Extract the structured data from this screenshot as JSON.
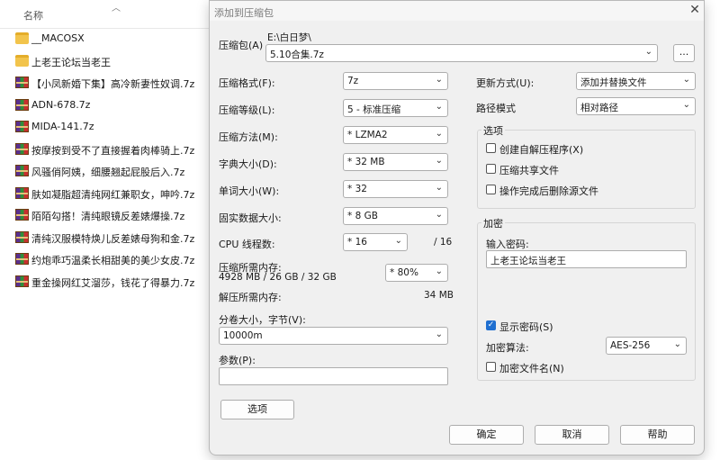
{
  "explorer": {
    "column_name": "名称",
    "files": [
      {
        "name": "__MACOSX",
        "icon": "folder-icon"
      },
      {
        "name": "上老王论坛当老王",
        "icon": "folder-icon"
      },
      {
        "name": "【小凤新婚下集】高冷新妻性奴调.7z",
        "icon": "rar-archive-icon"
      },
      {
        "name": "ADN-678.7z",
        "icon": "rar-archive-icon"
      },
      {
        "name": "MIDA-141.7z",
        "icon": "rar-archive-icon"
      },
      {
        "name": "按摩按到受不了直接握着肉棒骑上.7z",
        "icon": "rar-archive-icon"
      },
      {
        "name": "风骚俏阿姨，细腰翘起屁股后入.7z",
        "icon": "rar-archive-icon"
      },
      {
        "name": "肤如凝脂超清纯网红兼职女，呻吟.7z",
        "icon": "rar-archive-icon"
      },
      {
        "name": "陌陌勾搭！清纯眼镜反差婊爆操.7z",
        "icon": "rar-archive-icon"
      },
      {
        "name": "清纯汉服模特焕儿反差婊母狗和金.7z",
        "icon": "rar-archive-icon"
      },
      {
        "name": "约炮乖巧温柔长相甜美的美少女皮.7z",
        "icon": "rar-archive-icon"
      },
      {
        "name": "重金操网红艾溜莎，钱花了得暴力.7z",
        "icon": "rar-archive-icon"
      }
    ]
  },
  "dialog": {
    "title": "添加到压缩包",
    "archive": {
      "label": "压缩包(A)",
      "path": "E:\\白日梦\\",
      "filename": "5.10合集.7z",
      "browse_label": "..."
    },
    "format": {
      "label": "压缩格式(F):",
      "value": "7z"
    },
    "level": {
      "label": "压缩等级(L):",
      "value": "5 - 标准压缩"
    },
    "method": {
      "label": "压缩方法(M):",
      "value": "* LZMA2"
    },
    "dict": {
      "label": "字典大小(D):",
      "value": "* 32 MB"
    },
    "word": {
      "label": "单词大小(W):",
      "value": "* 32"
    },
    "solid": {
      "label": "固实数据大小:",
      "value": "* 8 GB"
    },
    "threads": {
      "label": "CPU 线程数:",
      "value": "* 16",
      "max": "/ 16"
    },
    "mem": {
      "label": "压缩所需内存:",
      "detail": "4928 MB / 26 GB / 32 GB",
      "value": "* 80%"
    },
    "decomp": {
      "label": "解压所需内存:",
      "value": "34 MB"
    },
    "split": {
      "label": "分卷大小，字节(V):",
      "value": "10000m"
    },
    "params": {
      "label": "参数(P):",
      "value": ""
    },
    "options_button": "选项",
    "update": {
      "label": "更新方式(U):",
      "value": "添加并替换文件"
    },
    "path_mode": {
      "label": "路径模式",
      "value": "相对路径"
    },
    "options_group": {
      "title": "选项",
      "sfx": "创建自解压程序(X)",
      "shared": "压缩共享文件",
      "delete": "操作完成后删除源文件"
    },
    "encryption": {
      "title": "加密",
      "pw_label": "输入密码:",
      "pw_value": "上老王论坛当老王",
      "show_pw": "显示密码(S)",
      "algo_label": "加密算法:",
      "algo_value": "AES-256",
      "encrypt_names": "加密文件名(N)"
    },
    "ok": "确定",
    "cancel": "取消",
    "help": "帮助"
  },
  "colors": {
    "accent": "#1f6fd0",
    "dialog_bg": "#f0f0f0"
  }
}
